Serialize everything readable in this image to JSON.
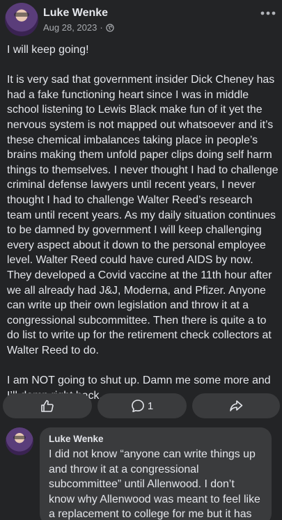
{
  "post": {
    "author": "Luke Wenke",
    "date": "Aug 28, 2023",
    "separator": "·",
    "privacy_icon": "globe-icon",
    "more_icon": "more-horizontal-icon",
    "paragraphs": [
      "I will keep going!",
      "It is very sad that government insider Dick Cheney has had a fake functioning heart since I was in middle school listening to Lewis Black make fun of it yet the nervous system is not mapped out whatsoever and it’s these chemical imbalances taking place in people’s brains making them unfold paper clips doing self harm things to themselves.  I never thought I had to challenge criminal defense lawyers until recent years, I never thought I had to challenge Walter Reed’s research team until recent years.  As my daily situation continues to be damned by government I will keep challenging every aspect about it down to the personal employee level.  Walter Reed could have cured AIDS by now.  They developed a Covid vaccine at the 11th hour after we all already had J&J, Moderna, and Pfizer.  Anyone can write up their own legislation and throw it at a congressional subcommittee.  Then there is quite a to do list to write up for the retirement check collectors at Walter Reed to do.",
      "I am NOT going to shut up.  Damn me some more and I’ll damn right back."
    ]
  },
  "actions": {
    "like_icon": "thumbs-up-icon",
    "comment_icon": "comment-icon",
    "comment_count": "1",
    "share_icon": "share-icon"
  },
  "comment": {
    "author": "Luke Wenke",
    "text": "I did not know “anyone can write things up and throw it at a congressional subcommittee” until Allenwood.  I don’t know why Allenwood was meant to feel like a replacement to college for me but it has"
  },
  "colors": {
    "background": "#232426",
    "bubble": "#3a3b3d",
    "text": "#e4e6eb",
    "muted": "#a8abaf"
  }
}
